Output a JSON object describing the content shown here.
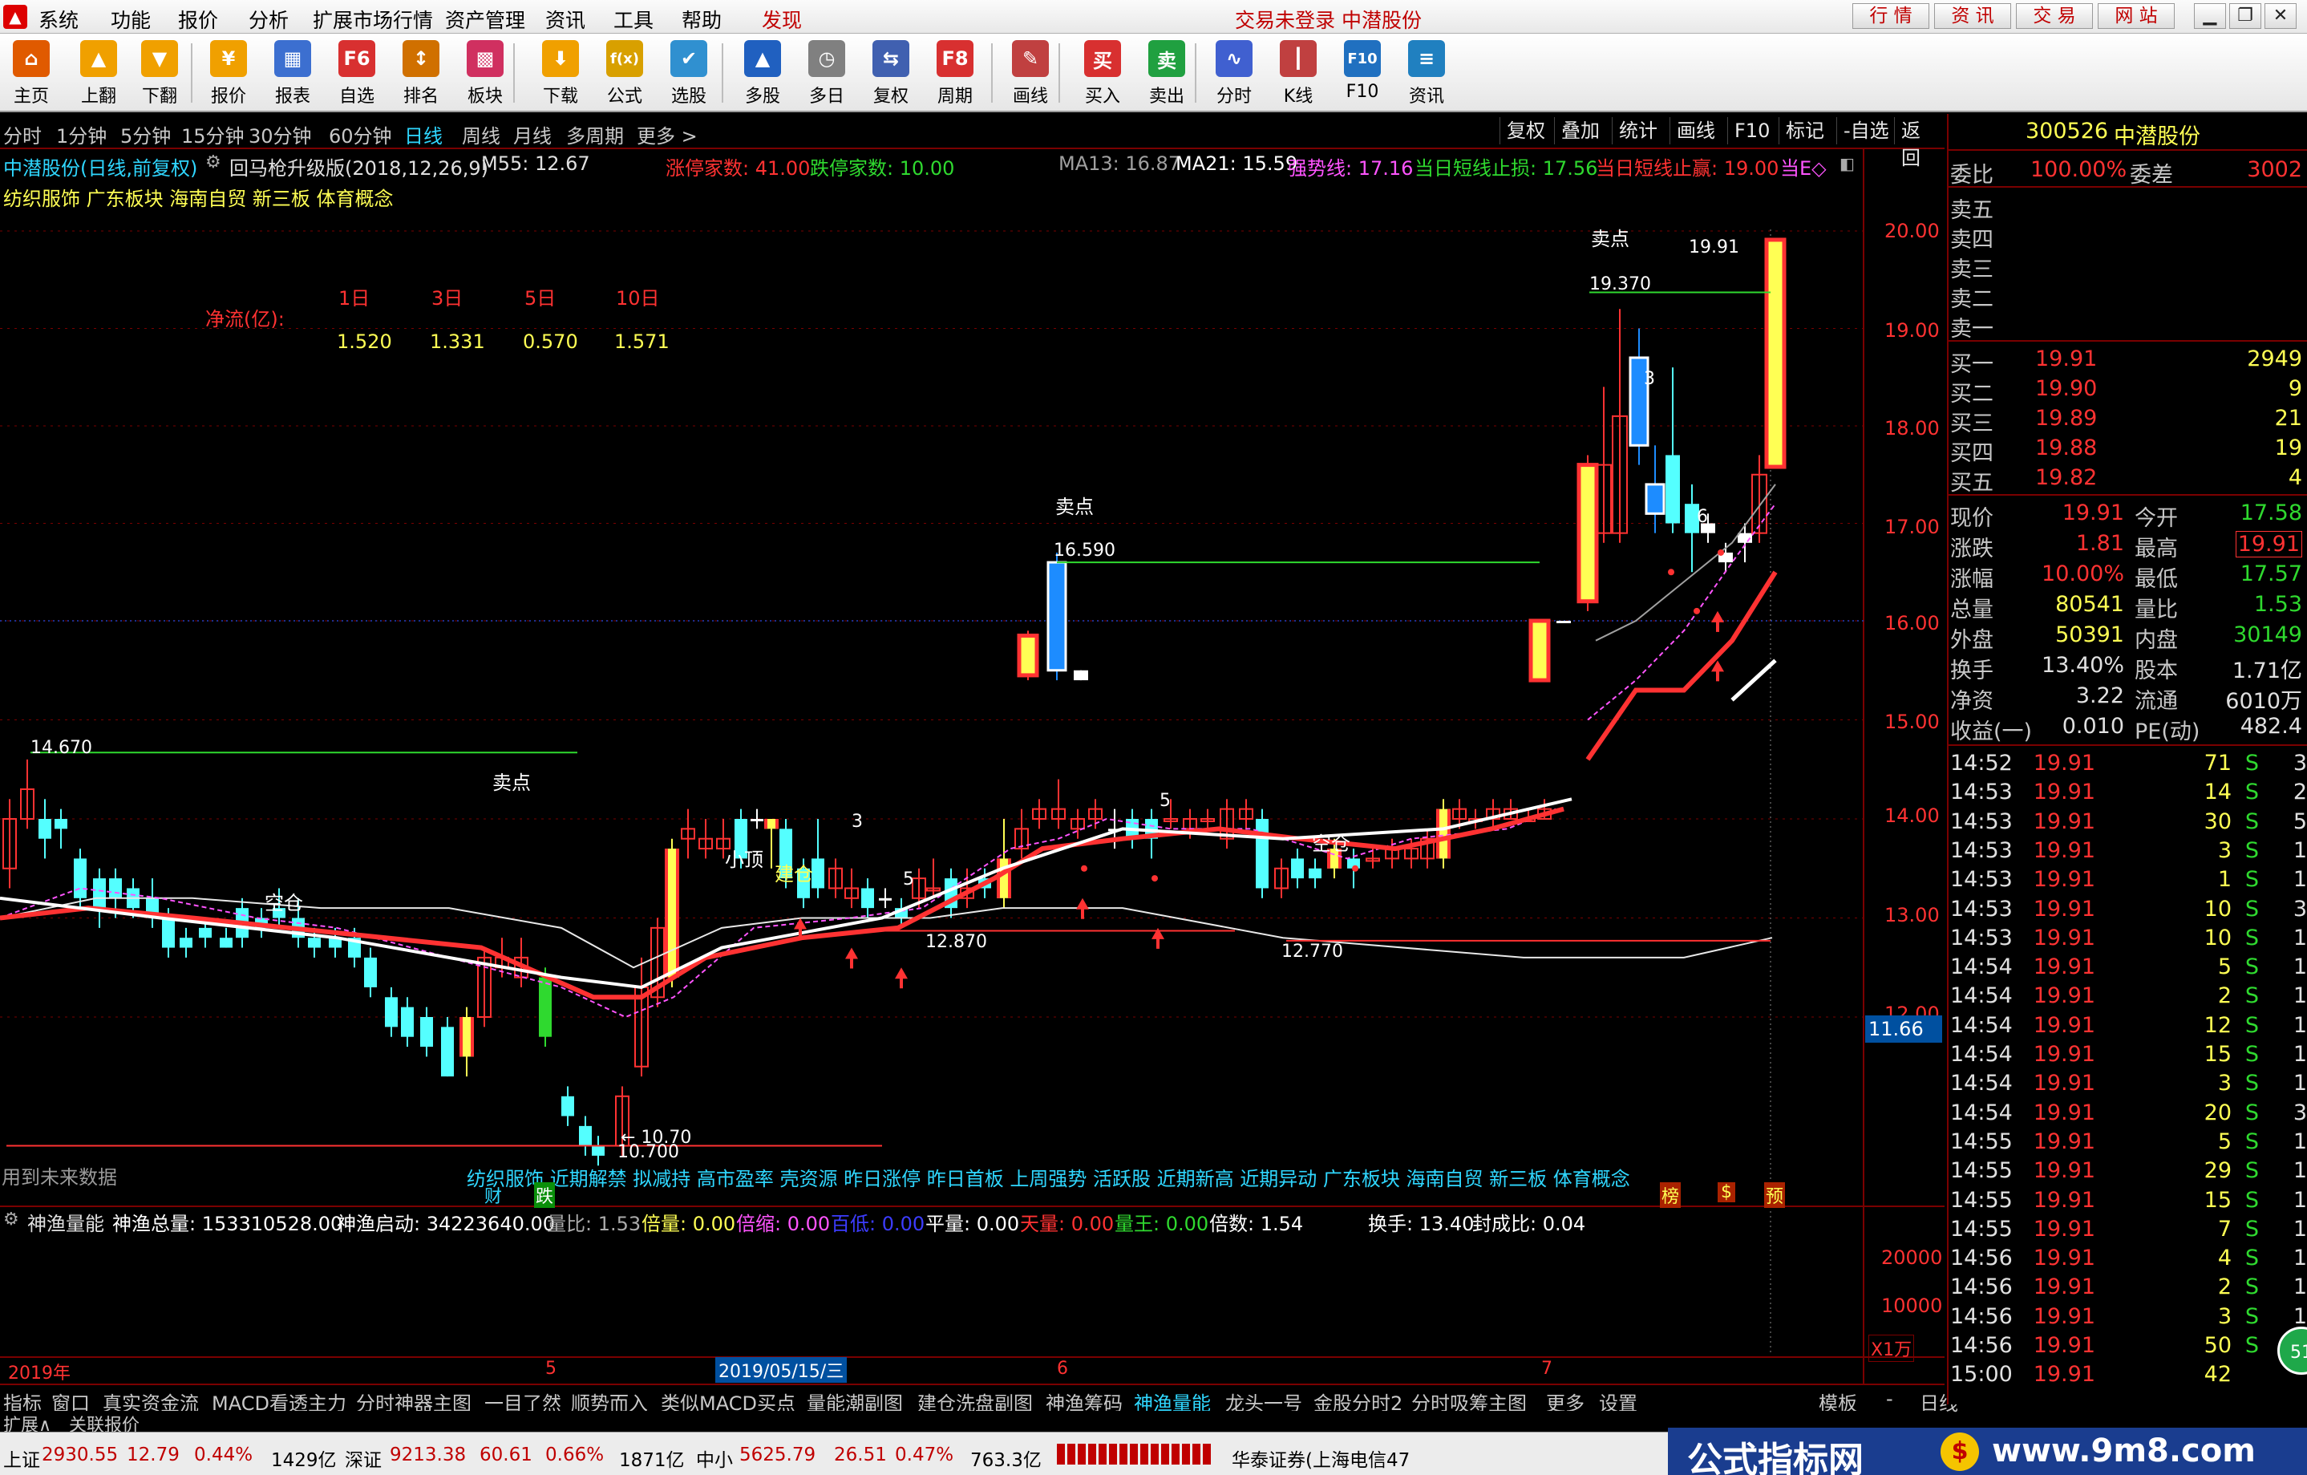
{
  "menu": {
    "items": [
      "系统",
      "功能",
      "报价",
      "分析",
      "扩展市场行情",
      "资产管理",
      "资讯",
      "工具",
      "帮助",
      "发现"
    ],
    "status_text": "交易未登录  中潜股份",
    "right_buttons": [
      "行 情",
      "资 讯",
      "交 易",
      "网 站"
    ]
  },
  "toolbar": [
    "主页",
    "上翻",
    "下翻",
    "报价",
    "报表",
    "自选",
    "排名",
    "板块",
    "下载",
    "公式",
    "选股",
    "多股",
    "多日",
    "复权",
    "周期",
    "画线",
    "买入",
    "卖出",
    "分时",
    "K线",
    "F10",
    "资讯"
  ],
  "toolbar_glyphs": [
    "⌂",
    "▲",
    "▼",
    "¥",
    "▦",
    "F6",
    "↕",
    "▩",
    "⬇",
    "f(x)",
    "✔",
    "▲",
    "◷",
    "⇆",
    "F8",
    "✎",
    "买",
    "卖",
    "∿",
    "┃",
    "F10",
    "≡"
  ],
  "periods": [
    "分时",
    "1分钟",
    "5分钟",
    "15分钟",
    "30分钟",
    "60分钟",
    "日线",
    "周线",
    "月线",
    "多周期",
    "更多 >"
  ],
  "active_period": "日线",
  "chart_buttons": [
    "复权",
    "叠加",
    "统计",
    "画线",
    "F10",
    "标记",
    "-自选",
    "返回"
  ],
  "info_line": {
    "stock": "中潜股份(日线,前复权)",
    "indicator": "回马枪升级版(2018,12,26,9)",
    "m55": "M55: 12.67",
    "limit_up": "涨停家数: 41.00",
    "limit_down": "跌停家数: 10.00",
    "ma13": "MA13: 16.87",
    "ma21": "MA21: 15.59",
    "strong": "强势线: 17.16",
    "stop": "当日短线止损: 17.56",
    "profit": "当日短线止赢: 19.00",
    "more": "当E◇"
  },
  "concepts": "纺织服饰 广东板块 海南自贸 新三板 体育概念",
  "net_flow": {
    "label": "净流(亿):",
    "periods": [
      "1日",
      "3日",
      "5日",
      "10日"
    ],
    "values": [
      "1.520",
      "1.331",
      "0.570",
      "1.571"
    ]
  },
  "price_axis": [
    "20.00",
    "19.00",
    "18.00",
    "17.00",
    "16.00",
    "15.00",
    "14.00",
    "13.00",
    "12.00",
    "11.66"
  ],
  "annotations": {
    "sell1": "卖点",
    "sell2": "卖点",
    "sell3": "卖点",
    "p14670": "14.670",
    "p16590": "16.590",
    "p19370": "19.370",
    "p1991": "19.91",
    "p12870": "12.870",
    "p12770": "12.770",
    "p10700": "10.700",
    "p10700b": "← 10.70",
    "empty1": "空仓",
    "empty2": "空仓",
    "small_top": "小顶",
    "build": "建仓",
    "n3a": "3",
    "n5a": "5",
    "n5b": "5",
    "n5c": "5",
    "n3b": "3",
    "n6": "6",
    "future": "用到未来数据",
    "signals": "纺织服饰 近期解禁 拟减持 高市盈率 壳资源 昨日涨停 昨日首板 上周强势 活跃股 近期新高 近期异动 广东板块 海南自贸 新三板 体育概念",
    "cai": "财",
    "die": "跌",
    "bang": "榜",
    "dollar": "$",
    "yu": "预"
  },
  "volume_info": {
    "name": "神渔量能",
    "total": "神渔总量: 153310528.00",
    "start": "神渔启动: 34223640.00",
    "qb": "量比: 1.53",
    "bei": "倍量: 0.00",
    "suo": "倍缩: 0.00",
    "bai": "百低: 0.00",
    "ping": "平量: 0.00",
    "tian": "天量: 0.00",
    "wang": "量王: 0.00",
    "beishu": "倍数: 1.54",
    "hs": "换手: 13.40",
    "fcb": "封成比: 0.04"
  },
  "vol_axis": [
    "20000",
    "10000",
    "X1万"
  ],
  "date_axis": {
    "y2019": "2019年",
    "m5": "5",
    "date": "2019/05/15/三",
    "m6": "6",
    "m7": "7"
  },
  "tabs": [
    "指标",
    "窗口",
    "真实资金流",
    "MACD看透主力",
    "分时神器主图",
    "一目了然",
    "顺势而入",
    "类似MACD买点",
    "量能潮副图",
    "建仓洗盘副图",
    "神渔筹码",
    "神渔量能",
    "龙头一号",
    "金股分时2",
    "分时吸筹主图",
    "更多",
    "设置"
  ],
  "active_tab": "神渔量能",
  "tab_right": [
    "模板",
    "-",
    "日线"
  ],
  "ext_tabs": [
    "扩展∧",
    "关联报价"
  ],
  "right_panel": {
    "code": "300526",
    "name": "中潜股份",
    "wb_label": "委比",
    "wb": "100.00%",
    "wc_label": "委差",
    "wc": "3002",
    "sell": [
      {
        "l": "卖五",
        "p": "",
        "v": ""
      },
      {
        "l": "卖四",
        "p": "",
        "v": ""
      },
      {
        "l": "卖三",
        "p": "",
        "v": ""
      },
      {
        "l": "卖二",
        "p": "",
        "v": ""
      },
      {
        "l": "卖一",
        "p": "",
        "v": ""
      }
    ],
    "buy": [
      {
        "l": "买一",
        "p": "19.91",
        "v": "2949"
      },
      {
        "l": "买二",
        "p": "19.90",
        "v": "9"
      },
      {
        "l": "买三",
        "p": "19.89",
        "v": "21"
      },
      {
        "l": "买四",
        "p": "19.88",
        "v": "19"
      },
      {
        "l": "买五",
        "p": "19.82",
        "v": "4"
      }
    ],
    "quote": [
      {
        "a": "现价",
        "b": "19.91",
        "c": "今开",
        "d": "17.58"
      },
      {
        "a": "涨跌",
        "b": "1.81",
        "c": "最高",
        "d": "19.91"
      },
      {
        "a": "涨幅",
        "b": "10.00%",
        "c": "最低",
        "d": "17.57"
      },
      {
        "a": "总量",
        "b": "80541",
        "c": "量比",
        "d": "1.53"
      },
      {
        "a": "外盘",
        "b": "50391",
        "c": "内盘",
        "d": "30149"
      },
      {
        "a": "换手",
        "b": "13.40%",
        "c": "股本",
        "d": "1.71亿"
      },
      {
        "a": "净资",
        "b": "3.22",
        "c": "流通",
        "d": "6010万"
      },
      {
        "a": "收益(一)",
        "b": "0.010",
        "c": "PE(动)",
        "d": "482.4"
      }
    ],
    "ticks": [
      {
        "t": "14:52",
        "p": "19.91",
        "v": "71",
        "s": "S",
        "n": "3"
      },
      {
        "t": "14:53",
        "p": "19.91",
        "v": "14",
        "s": "S",
        "n": "2"
      },
      {
        "t": "14:53",
        "p": "19.91",
        "v": "30",
        "s": "S",
        "n": "5"
      },
      {
        "t": "14:53",
        "p": "19.91",
        "v": "3",
        "s": "S",
        "n": "1"
      },
      {
        "t": "14:53",
        "p": "19.91",
        "v": "1",
        "s": "S",
        "n": "1"
      },
      {
        "t": "14:53",
        "p": "19.91",
        "v": "10",
        "s": "S",
        "n": "3"
      },
      {
        "t": "14:53",
        "p": "19.91",
        "v": "10",
        "s": "S",
        "n": "1"
      },
      {
        "t": "14:54",
        "p": "19.91",
        "v": "5",
        "s": "S",
        "n": "1"
      },
      {
        "t": "14:54",
        "p": "19.91",
        "v": "2",
        "s": "S",
        "n": "1"
      },
      {
        "t": "14:54",
        "p": "19.91",
        "v": "12",
        "s": "S",
        "n": "1"
      },
      {
        "t": "14:54",
        "p": "19.91",
        "v": "15",
        "s": "S",
        "n": "1"
      },
      {
        "t": "14:54",
        "p": "19.91",
        "v": "3",
        "s": "S",
        "n": "1"
      },
      {
        "t": "14:54",
        "p": "19.91",
        "v": "20",
        "s": "S",
        "n": "3"
      },
      {
        "t": "14:55",
        "p": "19.91",
        "v": "5",
        "s": "S",
        "n": "1"
      },
      {
        "t": "14:55",
        "p": "19.91",
        "v": "29",
        "s": "S",
        "n": "1"
      },
      {
        "t": "14:55",
        "p": "19.91",
        "v": "15",
        "s": "S",
        "n": "1"
      },
      {
        "t": "14:55",
        "p": "19.91",
        "v": "7",
        "s": "S",
        "n": "1"
      },
      {
        "t": "14:56",
        "p": "19.91",
        "v": "4",
        "s": "S",
        "n": "1"
      },
      {
        "t": "14:56",
        "p": "19.91",
        "v": "2",
        "s": "S",
        "n": "1"
      },
      {
        "t": "14:56",
        "p": "19.91",
        "v": "3",
        "s": "S",
        "n": "1"
      },
      {
        "t": "14:56",
        "p": "19.91",
        "v": "50",
        "s": "S",
        "n": "3"
      },
      {
        "t": "15:00",
        "p": "19.91",
        "v": "42",
        "s": "",
        "n": ""
      }
    ],
    "badge": "51"
  },
  "status": {
    "sh_label": "上证",
    "sh": "2930.55",
    "sh_chg": "12.79",
    "sh_pct": "0.44%",
    "sh_amt": "1429亿",
    "sz_label": "深证",
    "sz": "9213.38",
    "sz_chg": "60.61",
    "sz_pct": "0.66%",
    "sz_amt": "1871亿",
    "zx_label": "中小",
    "zx": "5625.79",
    "zx_chg": "26.51",
    "zx_pct": "0.47%",
    "zx_amt": "763.3亿",
    "broker": "华泰证券(上海电信47",
    "logo": "公式指标网",
    "site": "www.9m8.com"
  },
  "colors": {
    "up": "#ff3232",
    "down": "#54ffff",
    "accent_yellow": "#ffff54",
    "axis_red": "#7a0000"
  }
}
